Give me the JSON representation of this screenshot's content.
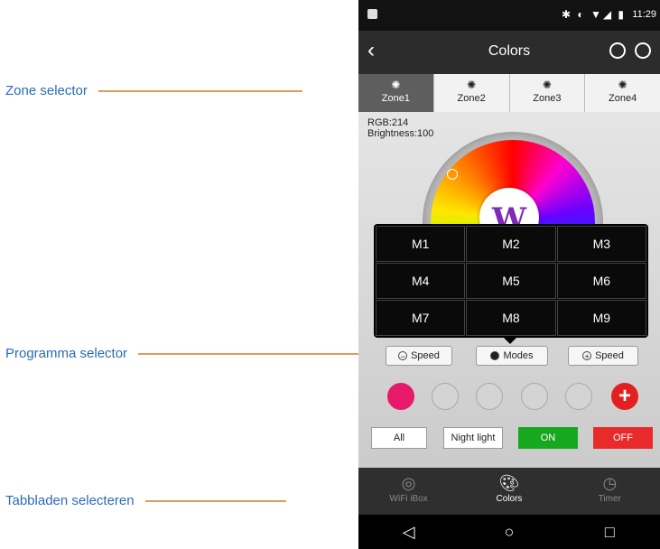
{
  "annotations": [
    {
      "text": "Zone selector"
    },
    {
      "text": "Programma selector"
    },
    {
      "text": "Tabbladen selecteren"
    }
  ],
  "statusbar": {
    "icons": "✱ ◐ ▼◢ ▮",
    "time": "11:29"
  },
  "header": {
    "title": "Colors",
    "back_icon": "chevron-left-icon",
    "right_icons": [
      "compass-icon",
      "menu-circle-icon"
    ]
  },
  "zones": [
    {
      "label": "Zone1",
      "active": true
    },
    {
      "label": "Zone2",
      "active": false
    },
    {
      "label": "Zone3",
      "active": false
    },
    {
      "label": "Zone4",
      "active": false
    }
  ],
  "info": {
    "rgb": "RGB:214",
    "brightness": "Brightness:100"
  },
  "wheel": {
    "center_label": "W"
  },
  "modes": [
    "M1",
    "M2",
    "M3",
    "M4",
    "M5",
    "M6",
    "M7",
    "M8",
    "M9"
  ],
  "controls": {
    "speed_down": "Speed",
    "modes": "Modes",
    "speed_up": "Speed"
  },
  "swatches": {
    "filled_color": "#e8196a",
    "add_color": "#e32020",
    "add_glyph": "+"
  },
  "buttons": {
    "all": "All",
    "night_light": "Night light",
    "on": "ON",
    "off": "OFF"
  },
  "tabs": [
    {
      "label": "WiFi iBox",
      "icon": "bulb-icon",
      "active": false
    },
    {
      "label": "Colors",
      "icon": "palette-icon",
      "active": true
    },
    {
      "label": "Timer",
      "icon": "clock-icon",
      "active": false
    }
  ],
  "navbar": {
    "back": "◁",
    "home": "○",
    "recent": "□"
  }
}
